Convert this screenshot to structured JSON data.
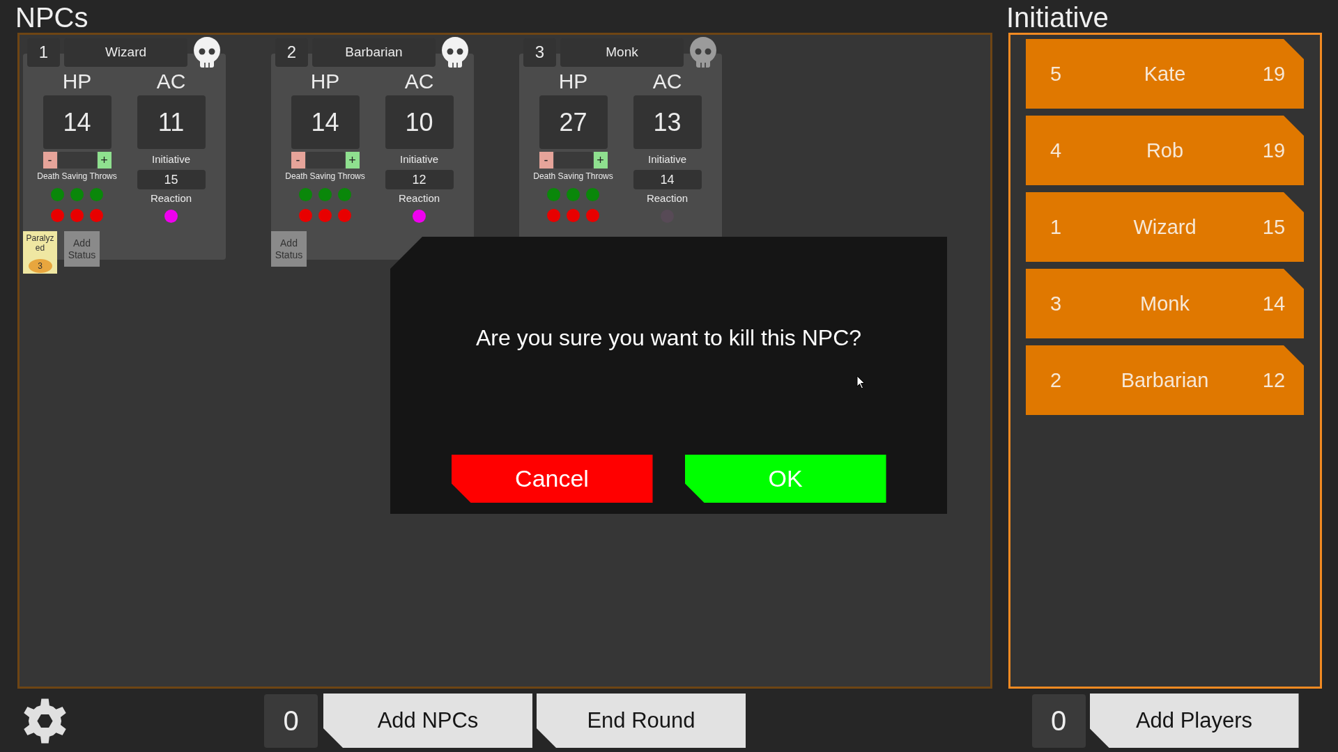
{
  "npc_panel": {
    "title": "NPCs",
    "cards": [
      {
        "number": "1",
        "name": "Wizard",
        "kill_pressed": false,
        "hp_label": "HP",
        "hp": "14",
        "hp_minus": "-",
        "hp_plus": "+",
        "death_saves_label": "Death Saving Throws",
        "ac_label": "AC",
        "ac": "11",
        "initiative_label": "Initiative",
        "initiative": "15",
        "reaction_label": "Reaction",
        "reaction_available": true,
        "statuses": [
          {
            "name": "Paralyzed",
            "rounds": "3"
          }
        ],
        "add_status": "Add Status"
      },
      {
        "number": "2",
        "name": "Barbarian",
        "kill_pressed": false,
        "hp_label": "HP",
        "hp": "14",
        "hp_minus": "-",
        "hp_plus": "+",
        "death_saves_label": "Death Saving Throws",
        "ac_label": "AC",
        "ac": "10",
        "initiative_label": "Initiative",
        "initiative": "12",
        "reaction_label": "Reaction",
        "reaction_available": true,
        "add_status": "Add Status"
      },
      {
        "number": "3",
        "name": "Monk",
        "kill_pressed": true,
        "hp_label": "HP",
        "hp": "27",
        "hp_minus": "-",
        "hp_plus": "+",
        "death_saves_label": "Death Saving Throws",
        "ac_label": "AC",
        "ac": "13",
        "initiative_label": "Initiative",
        "initiative": "14",
        "reaction_label": "Reaction",
        "reaction_available": false
      }
    ]
  },
  "initiative_panel": {
    "title": "Initiative",
    "entries": [
      {
        "number": "5",
        "name": "Kate",
        "initiative": "19"
      },
      {
        "number": "4",
        "name": "Rob",
        "initiative": "19"
      },
      {
        "number": "1",
        "name": "Wizard",
        "initiative": "15"
      },
      {
        "number": "3",
        "name": "Monk",
        "initiative": "14"
      },
      {
        "number": "2",
        "name": "Barbarian",
        "initiative": "12"
      }
    ]
  },
  "bottom_bar": {
    "npc_count": "0",
    "add_npcs": "Add NPCs",
    "end_round": "End Round",
    "player_count": "0",
    "add_players": "Add Players"
  },
  "dialog": {
    "message": "Are you sure you want to kill this NPC?",
    "buttons": [
      {
        "label": "Cancel",
        "kind": "cancel"
      },
      {
        "label": "OK",
        "kind": "confirm"
      }
    ]
  }
}
